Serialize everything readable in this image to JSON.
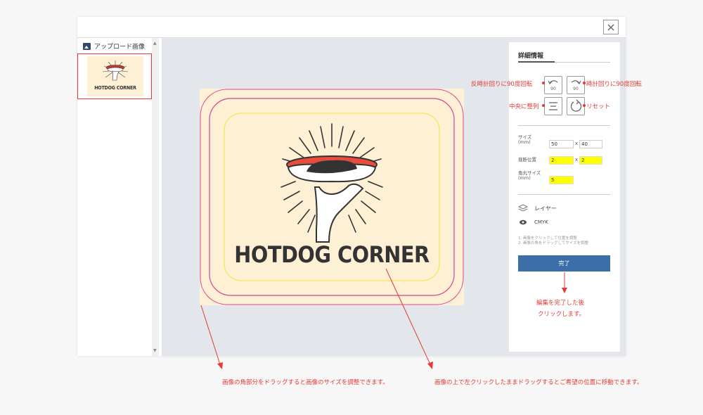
{
  "sidebar": {
    "header_label": "アップロード画像",
    "thumbnail_text": "HOTDOG CORNER"
  },
  "artwork": {
    "logo_text": "HOTDOG CORNER"
  },
  "panel": {
    "title": "詳細情報",
    "rotate_ccw_value": "90",
    "rotate_cw_value": "90",
    "size_label_line1": "サイズ",
    "size_label_line2": "(mm)",
    "size_width": "50",
    "size_height": "40",
    "cut_label": "裁断位置",
    "cut_x": "2",
    "cut_y": "2",
    "radius_label_line1": "角丸サイズ",
    "radius_label_line2": "(mm)",
    "radius_value": "5",
    "times_symbol": "x",
    "layer_label": "レイヤー",
    "cmyk_label": "CMYK",
    "hint_line1": "1. 画像をクリックして位置を調整",
    "hint_line2": "2. 画像の角をドラッグしてサイズを調整",
    "done_label": "完了"
  },
  "annotations": {
    "rotate_ccw": "反時計回りに90度回転",
    "rotate_cw": "時計回りに90度回転",
    "center": "中央に整列",
    "reset": "リセット",
    "done_line1": "編集を完了した後",
    "done_line2": "クリックします。",
    "corner_drag": "画像の角部分をドラッグすると画像のサイズを調整できます。",
    "image_drag": "画像の上で左クリックしたままドラッグするとご希望の位置に移動できます。"
  },
  "colors": {
    "accent": "#3c6ea7",
    "annotation": "#e53935",
    "highlight_field": "#ffff00",
    "art_background": "#fdf0d5",
    "outer_guide": "#d4458f",
    "safe_guide": "#f5e65a"
  }
}
